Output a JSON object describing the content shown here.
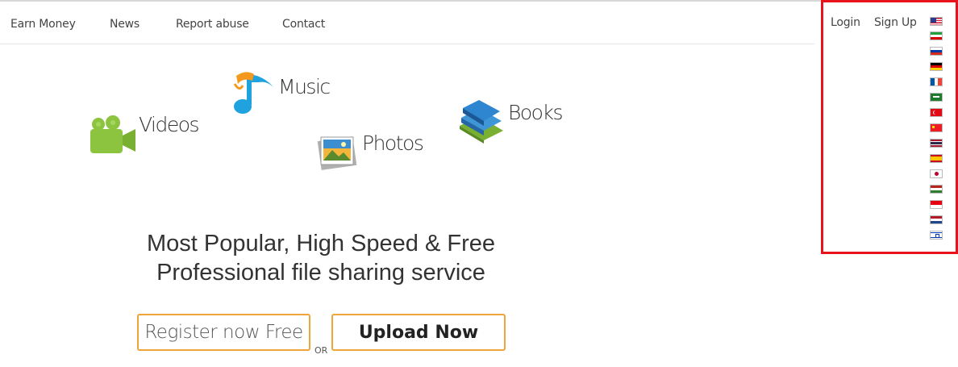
{
  "nav": {
    "items": [
      {
        "label": "Earn Money"
      },
      {
        "label": "News"
      },
      {
        "label": "Report abuse"
      },
      {
        "label": "Contact"
      }
    ]
  },
  "auth": {
    "login": "Login",
    "signup": "Sign Up"
  },
  "languages": [
    {
      "icon": "flag-us-icon"
    },
    {
      "icon": "flag-iran-icon"
    },
    {
      "icon": "flag-russia-icon"
    },
    {
      "icon": "flag-germany-icon"
    },
    {
      "icon": "flag-france-icon"
    },
    {
      "icon": "flag-saudi-icon"
    },
    {
      "icon": "flag-turkey-icon"
    },
    {
      "icon": "flag-china-icon"
    },
    {
      "icon": "flag-thailand-icon"
    },
    {
      "icon": "flag-spain-icon"
    },
    {
      "icon": "flag-japan-icon"
    },
    {
      "icon": "flag-afghanistan-icon"
    },
    {
      "icon": "flag-indonesia-icon"
    },
    {
      "icon": "flag-netherlands-icon"
    },
    {
      "icon": "flag-israel-icon"
    }
  ],
  "categories": {
    "videos": "Videos",
    "music": "Music",
    "photos": "Photos",
    "books": "Books"
  },
  "hero": {
    "line1": "Most Popular, High Speed & Free",
    "line2": "Professional file sharing service"
  },
  "actions": {
    "register": "Register now Free",
    "or": "OR",
    "upload": "Upload Now"
  },
  "colors": {
    "highlight_border": "#e8141c",
    "button_border": "#f0a43a"
  }
}
